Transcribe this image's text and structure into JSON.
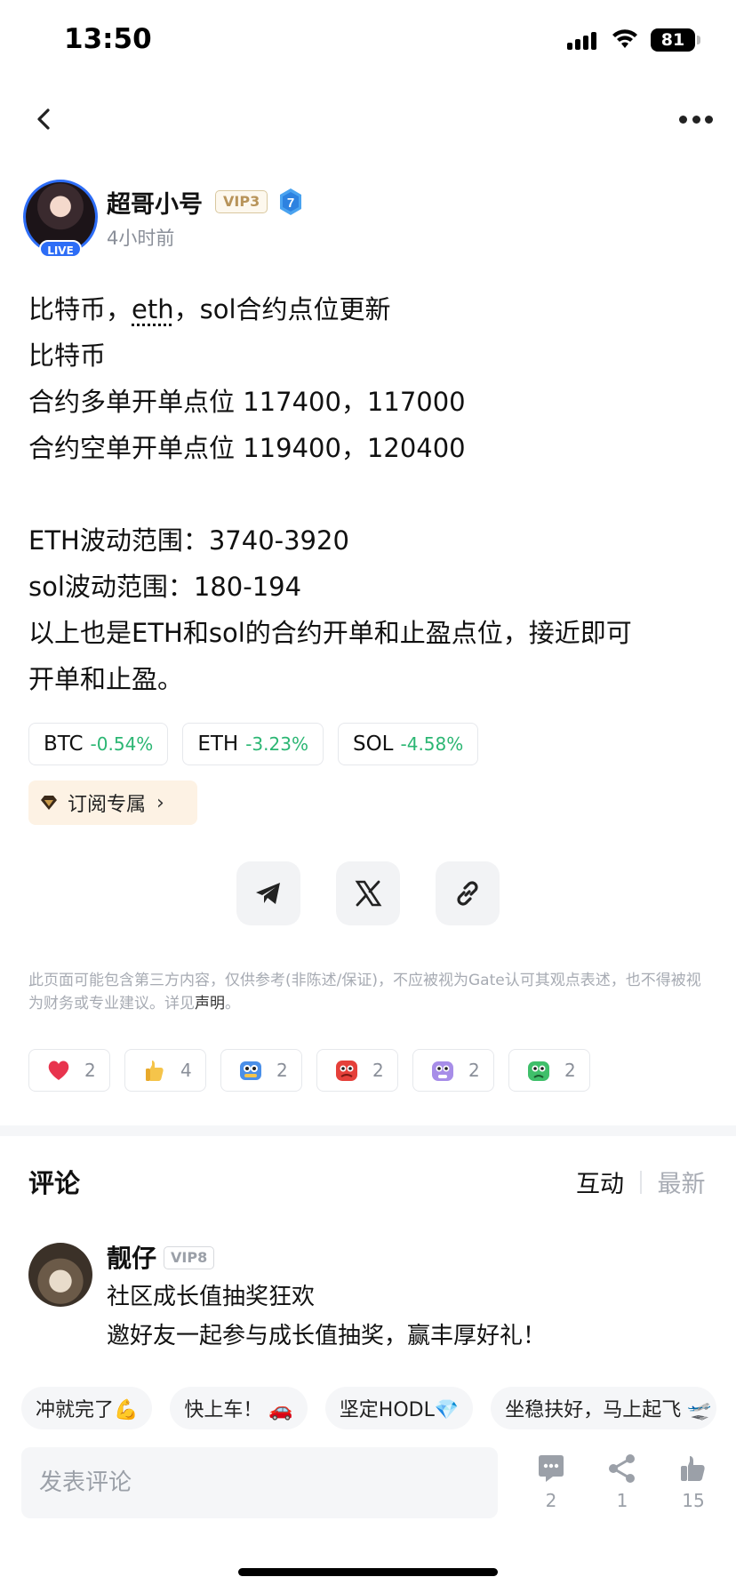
{
  "status_bar": {
    "time": "13:50",
    "battery": "81"
  },
  "author": {
    "name": "超哥小号",
    "vip": "VIP3",
    "level": "7",
    "live_badge": "LIVE",
    "time_ago": "4小时前"
  },
  "post": {
    "line1_pre": "比特币，",
    "line1_eth": "eth",
    "line1_post": "，sol合约点位更新",
    "lines": [
      "比特币",
      "合约多单开单点位 117400，117000",
      "合约空单开单点位 119400，120400",
      "",
      "ETH波动范围：3740-3920",
      "sol波动范围：180-194",
      "以上也是ETH和sol的合约开单和止盈点位，接近即可",
      "开单和止盈。"
    ]
  },
  "coins": [
    {
      "symbol": "BTC",
      "change": "-0.54%"
    },
    {
      "symbol": "ETH",
      "change": "-3.23%"
    },
    {
      "symbol": "SOL",
      "change": "-4.58%"
    }
  ],
  "subscribe": {
    "label": "订阅专属"
  },
  "disclaimer": {
    "text": "此页面可能包含第三方内容，仅供参考(非陈述/保证)，不应被视为Gate认可其观点表述，也不得被视为财务或专业建议。详见",
    "link": "声明",
    "end": "。"
  },
  "reactions": [
    {
      "icon": "heart-icon",
      "count": "2"
    },
    {
      "icon": "thumbs-up-icon",
      "count": "4"
    },
    {
      "icon": "hodl-bot-icon",
      "count": "2"
    },
    {
      "icon": "angry-face-icon",
      "count": "2"
    },
    {
      "icon": "purple-monster-icon",
      "count": "2"
    },
    {
      "icon": "green-monster-icon",
      "count": "2"
    }
  ],
  "comments": {
    "title": "评论",
    "sort_active": "互动",
    "sort_inactive": "最新",
    "first": {
      "name": "靓仔",
      "vip": "VIP8",
      "line1": "社区成长值抽奖狂欢",
      "line2": "邀好友一起参与成长值抽奖，赢丰厚好礼！"
    }
  },
  "quick_replies": [
    "冲就完了💪",
    "快上车！ 🚗",
    "坚定HODL💎",
    "坐稳扶好，马上起飞 🛫"
  ],
  "comment_input": {
    "placeholder": "发表评论"
  },
  "actions": {
    "comments": "2",
    "shares": "1",
    "likes": "15"
  },
  "colors": {
    "accent": "#2d6df6",
    "positive": "#2bb673",
    "muted": "#a7abb3"
  }
}
